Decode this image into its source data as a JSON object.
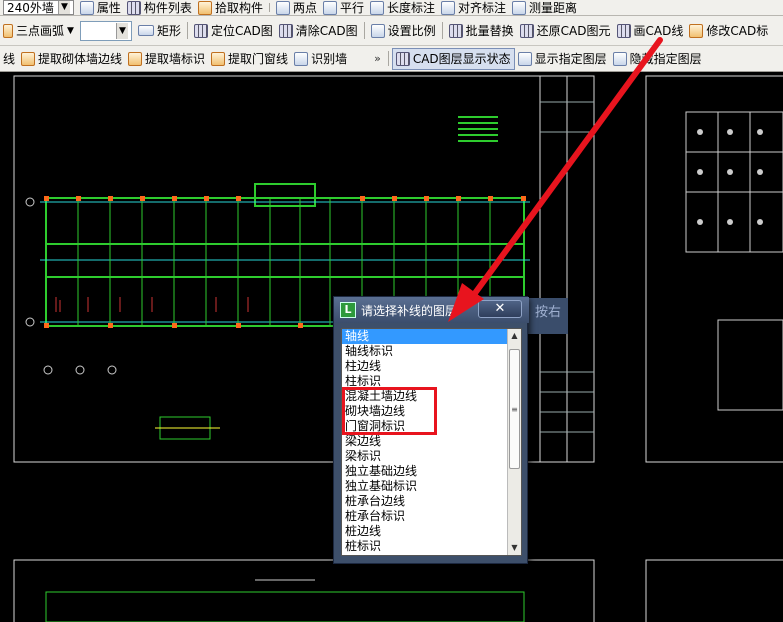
{
  "toolbar1": {
    "combo_value": "240外墙",
    "items": [
      "属性",
      "构件列表",
      "拾取构件",
      "两点",
      "平行",
      "长度标注",
      "对齐标注",
      "测量距离"
    ]
  },
  "toolbar2": {
    "arc_mode": "三点画弧",
    "rect": "矩形",
    "locate_cad": "定位CAD图",
    "clear_cad": "清除CAD图",
    "set_scale": "设置比例",
    "batch_replace": "批量替换",
    "restore_cad": "还原CAD图元",
    "draw_cad_line": "画CAD线",
    "modify_cad": "修改CAD标"
  },
  "toolbar3": {
    "line_tail": "线",
    "extract_masonry_edge": "提取砌体墙边线",
    "extract_wall_label": "提取墙标识",
    "extract_door_window": "提取门窗线",
    "identify_wall": "识别墙",
    "overflow": "»",
    "cad_layer_state": "CAD图层显示状态",
    "show_layer": "显示指定图层",
    "hide_layer": "隐藏指定图层"
  },
  "dialog": {
    "title": "请选择补线的图层",
    "close": "✕",
    "items": [
      "轴线",
      "轴线标识",
      "柱边线",
      "柱标识",
      "混凝土墙边线",
      "砌块墙边线",
      "门窗洞标识",
      "梁边线",
      "梁标识",
      "独立基础边线",
      "独立基础标识",
      "桩承台边线",
      "桩承台标识",
      "桩边线",
      "桩标识"
    ],
    "selected": "轴线"
  },
  "side_button": "按右",
  "colors": {
    "highlight": "#e8141e",
    "selection": "#3399ff",
    "cad_background": "#000000"
  }
}
